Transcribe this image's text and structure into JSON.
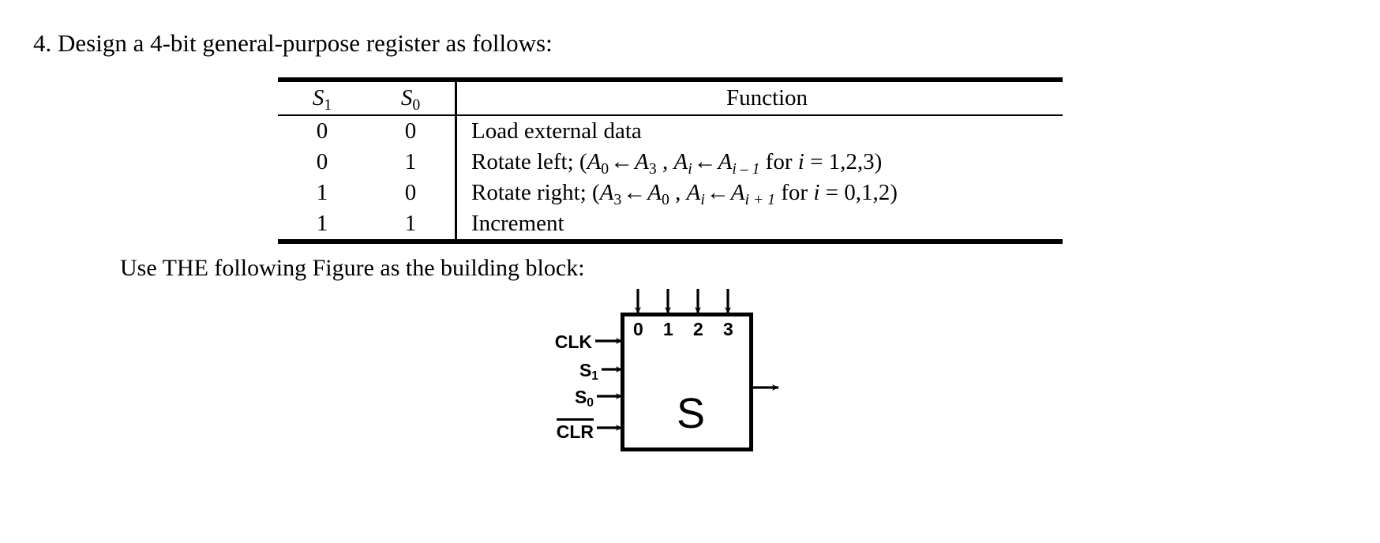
{
  "document": {
    "question_number": "4.",
    "heading": "4. Design a 4-bit general-purpose register as follows:",
    "use_figure_text": "Use THE  following Figure as the building block:"
  },
  "table": {
    "headers": {
      "s1": "S",
      "s1_sub": "1",
      "s0": "S",
      "s0_sub": "0",
      "function": "Function"
    },
    "rows": [
      {
        "s1": "0",
        "s0": "0",
        "function_plain": "Load external data",
        "function_type": "plain"
      },
      {
        "s1": "0",
        "s0": "1",
        "function_plain": "Rotate left; (A0 ←A3 , Ai ← Ai−1 for i = 1,2,3)",
        "function_type": "formula",
        "prefix": "Rotate left; (",
        "term1_base": "A",
        "term1_sub": "0",
        "arrow1": "←",
        "term2_base": "A",
        "term2_sub": "3",
        "comma": " , ",
        "term3_base": "A",
        "term3_sub": "i",
        "arrow2": "←",
        "term4_base": "A",
        "term4_sub": "i – 1",
        "suffix_for": " for ",
        "index_var": "i",
        "equals_values": " = 1,2,3)"
      },
      {
        "s1": "1",
        "s0": "0",
        "function_plain": "Rotate right; (A3 ←A0 , Ai ← Ai+1 for i = 0,1,2)",
        "function_type": "formula",
        "prefix": "Rotate right; (",
        "term1_base": "A",
        "term1_sub": "3",
        "arrow1": "←",
        "term2_base": "A",
        "term2_sub": "0",
        "comma": " , ",
        "term3_base": "A",
        "term3_sub": "i",
        "arrow2": "←",
        "term4_base": "A",
        "term4_sub": "i + 1",
        "suffix_for": " for ",
        "index_var": "i",
        "equals_values": " = 0,1,2)"
      },
      {
        "s1": "1",
        "s0": "1",
        "function_plain": "Increment",
        "function_type": "plain"
      }
    ]
  },
  "figure": {
    "block_letter": "S",
    "top_bit_labels": [
      "0",
      "1",
      "2",
      "3"
    ],
    "inputs": [
      {
        "label": "CLK",
        "overbar": false
      },
      {
        "label": "S",
        "sub": "1",
        "overbar": false
      },
      {
        "label": "S",
        "sub": "0",
        "overbar": false
      },
      {
        "label": "CLR",
        "overbar": true
      }
    ],
    "output_arrow": "right-output",
    "input_arrow_count": 4,
    "top_arrow_count": 4
  },
  "colors": {
    "ink": "#000000",
    "page": "#ffffff"
  }
}
